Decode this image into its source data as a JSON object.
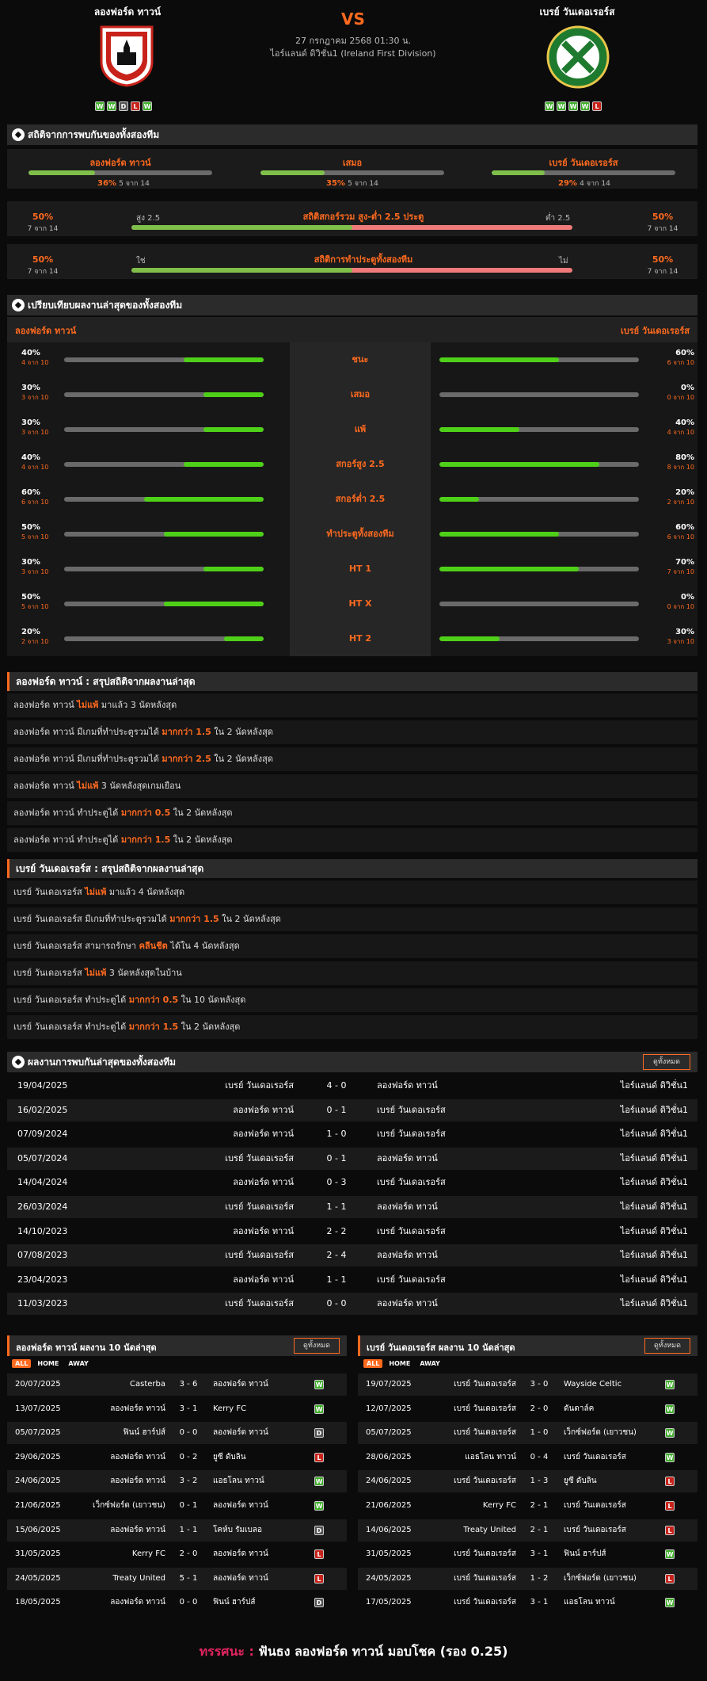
{
  "header": {
    "home": "ลองฟอร์ด ทาวน์",
    "away": "เบรย์ วันเดอเรอร์ส",
    "vs": "VS",
    "date": "27 กรกฎาคม 2568 01:30 น.",
    "league": "ไอร์แลนด์ ดิวิชั่น1 (Ireland First Division)",
    "home_form": [
      "W",
      "W",
      "D",
      "L",
      "W"
    ],
    "away_form": [
      "W",
      "W",
      "W",
      "W",
      "L"
    ],
    "home_crest_text": "LONGFORD TOWN FC",
    "away_crest_text": "BRAY WANDERERS FOOTBALL CLUB"
  },
  "h2h_stats": {
    "title": "สถิติจากการพบกันของทั้งสองทีม",
    "home": {
      "label": "ลองฟอร์ด ทาวน์",
      "pct": "36%",
      "detail": "5 จาก 14",
      "value": 0.36
    },
    "draw": {
      "label": "เสมอ",
      "pct": "35%",
      "detail": "5 จาก 14",
      "value": 0.35
    },
    "away": {
      "label": "เบรย์ วันเดอเรอร์ส",
      "pct": "29%",
      "detail": "4 จาก 14",
      "value": 0.29
    },
    "goals": {
      "title": "สถิติสกอร์รวม สูง-ต่ำ 2.5 ประตู",
      "left_pct": "50%",
      "left_detail": "7 จาก 14",
      "right_pct": "50%",
      "right_detail": "7 จาก 14",
      "left_label": "สูง 2.5",
      "right_label": "ต่ำ 2.5",
      "value": 0.5
    },
    "btts": {
      "title": "สถิติการทำประตูทั้งสองทีม",
      "left_pct": "50%",
      "left_detail": "7 จาก 14",
      "right_pct": "50%",
      "right_detail": "7 จาก 14",
      "left_label": "ใช่",
      "right_label": "ไม่",
      "value": 0.5
    }
  },
  "compare": {
    "title": "เปรียบเทียบผลงานล่าสุดของทั้งสองทีม",
    "home": "ลองฟอร์ด ทาวน์",
    "away": "เบรย์ วันเดอเรอร์ส",
    "rows": [
      {
        "label": "ชนะ",
        "hp": "40%",
        "hd": "4 จาก 10",
        "hv": 0.4,
        "ap": "60%",
        "ad": "6 จาก 10",
        "av": 0.6
      },
      {
        "label": "เสมอ",
        "hp": "30%",
        "hd": "3 จาก 10",
        "hv": 0.3,
        "ap": "0%",
        "ad": "0 จาก 10",
        "av": 0
      },
      {
        "label": "แพ้",
        "hp": "30%",
        "hd": "3 จาก 10",
        "hv": 0.3,
        "ap": "40%",
        "ad": "4 จาก 10",
        "av": 0.4
      },
      {
        "label": "สกอร์สูง 2.5",
        "hp": "40%",
        "hd": "4 จาก 10",
        "hv": 0.4,
        "ap": "80%",
        "ad": "8 จาก 10",
        "av": 0.8
      },
      {
        "label": "สกอร์ต่ำ 2.5",
        "hp": "60%",
        "hd": "6 จาก 10",
        "hv": 0.6,
        "ap": "20%",
        "ad": "2 จาก 10",
        "av": 0.2
      },
      {
        "label": "ทำประตูทั้งสองทีม",
        "hp": "50%",
        "hd": "5 จาก 10",
        "hv": 0.5,
        "ap": "60%",
        "ad": "6 จาก 10",
        "av": 0.6
      },
      {
        "label": "HT 1",
        "hp": "30%",
        "hd": "3 จาก 10",
        "hv": 0.3,
        "ap": "70%",
        "ad": "7 จาก 10",
        "av": 0.7
      },
      {
        "label": "HT X",
        "hp": "50%",
        "hd": "5 จาก 10",
        "hv": 0.5,
        "ap": "0%",
        "ad": "0 จาก 10",
        "av": 0
      },
      {
        "label": "HT 2",
        "hp": "20%",
        "hd": "2 จาก 10",
        "hv": 0.2,
        "ap": "30%",
        "ad": "3 จาก 10",
        "av": 0.3
      }
    ]
  },
  "home_summary": {
    "title": "ลองฟอร์ด ทาวน์ : สรุปสถิติจากผลงานล่าสุด",
    "rows": [
      [
        "ลองฟอร์ด ทาวน์ ",
        "ไม่แพ้",
        " มาแล้ว 3 นัดหลังสุด"
      ],
      [
        "ลองฟอร์ด ทาวน์ มีเกมที่ทำประตูรวมได้ ",
        "มากกว่า 1.5",
        " ใน 2 นัดหลังสุด"
      ],
      [
        "ลองฟอร์ด ทาวน์ มีเกมที่ทำประตูรวมได้ ",
        "มากกว่า 2.5",
        " ใน 2 นัดหลังสุด"
      ],
      [
        "ลองฟอร์ด ทาวน์ ",
        "ไม่แพ้",
        " 3 นัดหลังสุดเกมเยือน"
      ],
      [
        "ลองฟอร์ด ทาวน์ ทำประตูได้ ",
        "มากกว่า 0.5",
        " ใน 2 นัดหลังสุด"
      ],
      [
        "ลองฟอร์ด ทาวน์ ทำประตูได้ ",
        "มากกว่า 1.5",
        " ใน 2 นัดหลังสุด"
      ]
    ]
  },
  "away_summary": {
    "title": "เบรย์ วันเดอเรอร์ส : สรุปสถิติจากผลงานล่าสุด",
    "rows": [
      [
        "เบรย์ วันเดอเรอร์ส ",
        "ไม่แพ้",
        " มาแล้ว 4 นัดหลังสุด"
      ],
      [
        "เบรย์ วันเดอเรอร์ส มีเกมที่ทำประตูรวมได้ ",
        "มากกว่า 1.5",
        " ใน 2 นัดหลังสุด"
      ],
      [
        "เบรย์ วันเดอเรอร์ส สามารถรักษา ",
        "คลีนชีต",
        " ได้ใน 4 นัดหลังสุด"
      ],
      [
        "เบรย์ วันเดอเรอร์ส ",
        "ไม่แพ้",
        " 3 นัดหลังสุดในบ้าน"
      ],
      [
        "เบรย์ วันเดอเรอร์ส ทำประตูได้ ",
        "มากกว่า 0.5",
        " ใน 10 นัดหลังสุด"
      ],
      [
        "เบรย์ วันเดอเรอร์ส ทำประตูได้ ",
        "มากกว่า 1.5",
        " ใน 2 นัดหลังสุด"
      ]
    ]
  },
  "h2h_results": {
    "title": "ผลงานการพบกันล่าสุดของทั้งสองทีม",
    "view_all": "ดูทั้งหมด",
    "rows": [
      [
        "19/04/2025",
        "เบรย์ วันเดอเรอร์ส",
        "4 - 0",
        "ลองฟอร์ด ทาวน์",
        "ไอร์แลนด์ ดิวิชั่น1"
      ],
      [
        "16/02/2025",
        "ลองฟอร์ด ทาวน์",
        "0 - 1",
        "เบรย์ วันเดอเรอร์ส",
        "ไอร์แลนด์ ดิวิชั่น1"
      ],
      [
        "07/09/2024",
        "ลองฟอร์ด ทาวน์",
        "1 - 0",
        "เบรย์ วันเดอเรอร์ส",
        "ไอร์แลนด์ ดิวิชั่น1"
      ],
      [
        "05/07/2024",
        "เบรย์ วันเดอเรอร์ส",
        "0 - 1",
        "ลองฟอร์ด ทาวน์",
        "ไอร์แลนด์ ดิวิชั่น1"
      ],
      [
        "14/04/2024",
        "ลองฟอร์ด ทาวน์",
        "0 - 3",
        "เบรย์ วันเดอเรอร์ส",
        "ไอร์แลนด์ ดิวิชั่น1"
      ],
      [
        "26/03/2024",
        "เบรย์ วันเดอเรอร์ส",
        "1 - 1",
        "ลองฟอร์ด ทาวน์",
        "ไอร์แลนด์ ดิวิชั่น1"
      ],
      [
        "14/10/2023",
        "ลองฟอร์ด ทาวน์",
        "2 - 2",
        "เบรย์ วันเดอเรอร์ส",
        "ไอร์แลนด์ ดิวิชั่น1"
      ],
      [
        "07/08/2023",
        "เบรย์ วันเดอเรอร์ส",
        "2 - 4",
        "ลองฟอร์ด ทาวน์",
        "ไอร์แลนด์ ดิวิชั่น1"
      ],
      [
        "23/04/2023",
        "ลองฟอร์ด ทาวน์",
        "1 - 1",
        "เบรย์ วันเดอเรอร์ส",
        "ไอร์แลนด์ ดิวิชั่น1"
      ],
      [
        "11/03/2023",
        "เบรย์ วันเดอเรอร์ส",
        "0 - 0",
        "ลองฟอร์ด ทาวน์",
        "ไอร์แลนด์ ดิวิชั่น1"
      ]
    ]
  },
  "home_last10": {
    "title": "ลองฟอร์ด ทาวน์ ผลงาน 10 นัดล่าสุด",
    "view_all": "ดูทั้งหมด",
    "tabs": [
      "ALL",
      "HOME",
      "AWAY"
    ],
    "rows": [
      [
        "20/07/2025",
        "Casterba",
        "3 - 6",
        "ลองฟอร์ด ทาวน์",
        "W"
      ],
      [
        "13/07/2025",
        "ลองฟอร์ด ทาวน์",
        "3 - 1",
        "Kerry FC",
        "W"
      ],
      [
        "05/07/2025",
        "ฟินน์ ฮาร์ปส์",
        "0 - 0",
        "ลองฟอร์ด ทาวน์",
        "D"
      ],
      [
        "29/06/2025",
        "ลองฟอร์ด ทาวน์",
        "0 - 2",
        "ยูซี ดับลิน",
        "L"
      ],
      [
        "24/06/2025",
        "ลองฟอร์ด ทาวน์",
        "3 - 2",
        "แอธโลน ทาวน์",
        "W"
      ],
      [
        "21/06/2025",
        "เว็กซ์ฟอร์ด (เยาวชน)",
        "0 - 1",
        "ลองฟอร์ด ทาวน์",
        "W"
      ],
      [
        "15/06/2025",
        "ลองฟอร์ด ทาวน์",
        "1 - 1",
        "โคห์บ รัมเบลอ",
        "D"
      ],
      [
        "31/05/2025",
        "Kerry FC",
        "2 - 0",
        "ลองฟอร์ด ทาวน์",
        "L"
      ],
      [
        "24/05/2025",
        "Treaty United",
        "5 - 1",
        "ลองฟอร์ด ทาวน์",
        "L"
      ],
      [
        "18/05/2025",
        "ลองฟอร์ด ทาวน์",
        "0 - 0",
        "ฟินน์ ฮาร์ปส์",
        "D"
      ]
    ]
  },
  "away_last10": {
    "title": "เบรย์ วันเดอเรอร์ส ผลงาน 10 นัดล่าสุด",
    "view_all": "ดูทั้งหมด",
    "tabs": [
      "ALL",
      "HOME",
      "AWAY"
    ],
    "rows": [
      [
        "19/07/2025",
        "เบรย์ วันเดอเรอร์ส",
        "3 - 0",
        "Wayside Celtic",
        "W"
      ],
      [
        "12/07/2025",
        "เบรย์ วันเดอเรอร์ส",
        "2 - 0",
        "ดันดาล์ค",
        "W"
      ],
      [
        "05/07/2025",
        "เบรย์ วันเดอเรอร์ส",
        "1 - 0",
        "เว็กซ์ฟอร์ด (เยาวชน)",
        "W"
      ],
      [
        "28/06/2025",
        "แอธโลน ทาวน์",
        "0 - 4",
        "เบรย์ วันเดอเรอร์ส",
        "W"
      ],
      [
        "24/06/2025",
        "เบรย์ วันเดอเรอร์ส",
        "1 - 3",
        "ยูซี ดับลิน",
        "L"
      ],
      [
        "21/06/2025",
        "Kerry FC",
        "2 - 1",
        "เบรย์ วันเดอเรอร์ส",
        "L"
      ],
      [
        "14/06/2025",
        "Treaty United",
        "2 - 1",
        "เบรย์ วันเดอเรอร์ส",
        "L"
      ],
      [
        "31/05/2025",
        "เบรย์ วันเดอเรอร์ส",
        "3 - 1",
        "ฟินน์ ฮาร์ปส์",
        "W"
      ],
      [
        "24/05/2025",
        "เบรย์ วันเดอเรอร์ส",
        "1 - 2",
        "เว็กซ์ฟอร์ด (เยาวชน)",
        "L"
      ],
      [
        "17/05/2025",
        "เบรย์ วันเดอเรอร์ส",
        "3 - 1",
        "แอธโลน ทาวน์",
        "W"
      ]
    ]
  },
  "verdict": {
    "label": "ทรรศนะ :",
    "text": "ฟันธง ลองฟอร์ด ทาวน์ มอบโชค (รอง 0.25)"
  },
  "colors": {
    "accent": "#ff6a1f",
    "green": "#4fd018",
    "win": "#3fae2a",
    "loss": "#c8231b",
    "draw": "#555555"
  }
}
